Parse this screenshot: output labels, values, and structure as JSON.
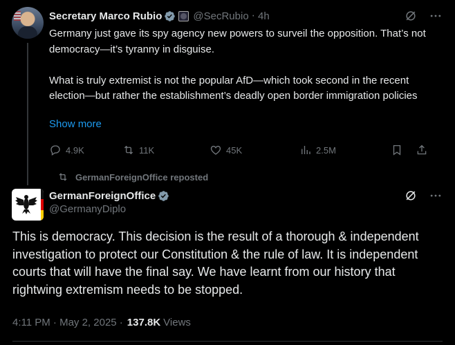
{
  "tweet1": {
    "author_name": "Secretary Marco Rubio",
    "handle": "@SecRubio",
    "time": "4h",
    "text": "Germany just gave its spy agency new powers to surveil the opposition. That’s not democracy—it’s tyranny in disguise.\n\nWhat is truly extremist is not the popular AfD—which took second in the recent election—but rather the establishment’s deadly open border immigration policies",
    "show_more": "Show more",
    "replies": "4.9K",
    "reposts": "11K",
    "likes": "45K",
    "views": "2.5M"
  },
  "repost_label": "GermanForeignOffice reposted",
  "tweet2": {
    "author_name": "GermanForeignOffice",
    "handle": "@GermanyDiplo",
    "text": "This is democracy. This decision is the result of a thorough & independent investigation to protect our Constitution & the rule of law. It is independent courts that will have the final say. We have learnt from our history that rightwing extremism needs to be stopped.",
    "timestamp": "4:11 PM · May 2, 2025 ·",
    "views_count": "137.8K",
    "views_label": "Views"
  },
  "colors": {
    "background": "#000000",
    "text": "#e7e9ea",
    "muted": "#71767b",
    "link": "#1d9bf0",
    "verified": "#829aab"
  }
}
